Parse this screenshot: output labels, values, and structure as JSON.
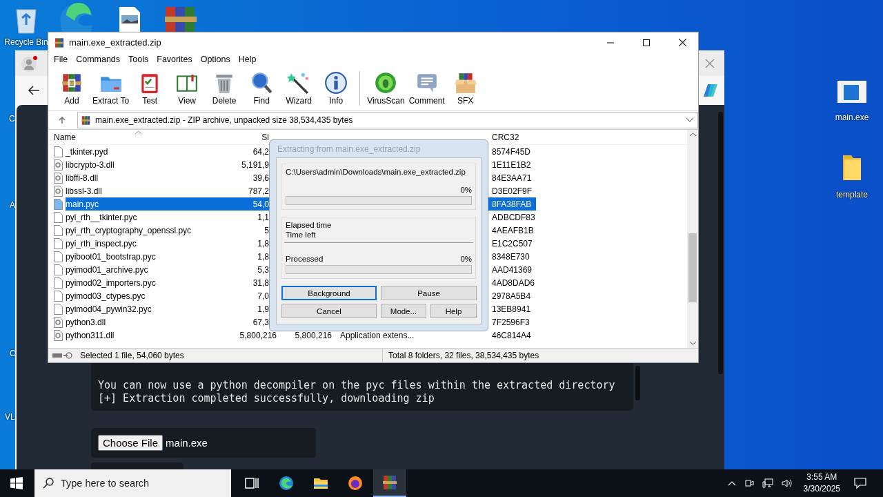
{
  "desktop": {
    "top_icons": [
      {
        "label": "Recycle Bin"
      }
    ],
    "left_edge_labels": [
      "C",
      "A",
      "C",
      "VL"
    ],
    "right_icons": [
      {
        "label": "main.exe",
        "kind": "app"
      },
      {
        "label": "template",
        "kind": "folder"
      }
    ]
  },
  "browser": {
    "terminal_lines": [
      "You can now use a python decompiler on the pyc files within the extracted directory",
      "[+] Extraction completed successfully, downloading zip"
    ],
    "file_button": "Choose File",
    "file_name": "main.exe"
  },
  "winrar": {
    "title": "main.exe_extracted.zip",
    "menu": [
      "File",
      "Commands",
      "Tools",
      "Favorites",
      "Options",
      "Help"
    ],
    "toolbar": [
      [
        "Add",
        "Extract To",
        "Test",
        "View",
        "Delete",
        "Find",
        "Wizard",
        "Info"
      ],
      [
        "VirusScan",
        "Comment",
        "SFX"
      ]
    ],
    "address": "main.exe_extracted.zip - ZIP archive, unpacked size 38,534,435 bytes",
    "columns": {
      "name": "Name",
      "size": "Si",
      "crc": "CRC32"
    },
    "rows": [
      {
        "name": "_tkinter.pyd",
        "kind": "file",
        "size": "64,2",
        "crc": "8574F45D",
        "selected": false
      },
      {
        "name": "libcrypto-3.dll",
        "kind": "dll",
        "size": "5,191,9",
        "crc": "1E11E1B2",
        "selected": false
      },
      {
        "name": "libffi-8.dll",
        "kind": "dll",
        "size": "39,6",
        "crc": "84E3AA71",
        "selected": false
      },
      {
        "name": "libssl-3.dll",
        "kind": "dll",
        "size": "787,2",
        "crc": "D3E02F9F",
        "selected": false
      },
      {
        "name": "main.pyc",
        "kind": "file",
        "size": "54,0",
        "crc": "8FA38FAB",
        "selected": true
      },
      {
        "name": "pyi_rth__tkinter.pyc",
        "kind": "file",
        "size": "1,1",
        "crc": "ADBCDF83",
        "selected": false
      },
      {
        "name": "pyi_rth_cryptography_openssl.pyc",
        "kind": "file",
        "size": "5",
        "crc": "4AEAFB1B",
        "selected": false
      },
      {
        "name": "pyi_rth_inspect.pyc",
        "kind": "file",
        "size": "1,8",
        "crc": "E1C2C507",
        "selected": false
      },
      {
        "name": "pyiboot01_bootstrap.pyc",
        "kind": "file",
        "size": "1,8",
        "crc": "8348E730",
        "selected": false
      },
      {
        "name": "pyimod01_archive.pyc",
        "kind": "file",
        "size": "5,3",
        "crc": "AAD41369",
        "selected": false
      },
      {
        "name": "pyimod02_importers.pyc",
        "kind": "file",
        "size": "31,8",
        "crc": "4AD8DAD6",
        "selected": false
      },
      {
        "name": "pyimod03_ctypes.pyc",
        "kind": "file",
        "size": "7,0",
        "crc": "2978A5B4",
        "selected": false
      },
      {
        "name": "pyimod04_pywin32.pyc",
        "kind": "file",
        "size": "1,9",
        "crc": "13EB8941",
        "selected": false
      },
      {
        "name": "python3.dll",
        "kind": "dll",
        "size": "67,3",
        "crc": "7F2596F3",
        "selected": false
      },
      {
        "name": "python311.dll",
        "kind": "dll",
        "size": "5,800,216",
        "packed": "5,800,216",
        "type": "Application extens...",
        "crc": "46C814A4",
        "selected": false
      }
    ],
    "status_left": "Selected 1 file, 54,060 bytes",
    "status_right": "Total 8 folders, 32 files, 38,534,435 bytes"
  },
  "dialog": {
    "title": "Extracting from main.exe_extracted.zip",
    "path": "C:\\Users\\admin\\Downloads\\main.exe_extracted.zip",
    "file_percent": "0%",
    "file_bar": {
      "level": 0
    },
    "elapsed_label": "Elapsed time",
    "time_left_label": "Time left",
    "processed_label": "Processed",
    "total_percent": "0%",
    "total_bar": {
      "level": 0
    },
    "buttons": [
      {
        "label": "Background",
        "focused": true
      },
      {
        "label": "Pause",
        "focused": false
      },
      {
        "label": "Cancel",
        "focused": false
      },
      {
        "label": "Mode...",
        "focused": false
      },
      {
        "label": "Help",
        "focused": false
      }
    ]
  },
  "taskbar": {
    "search_placeholder": "Type here to search",
    "apps": [
      {
        "selected": false
      },
      {
        "selected": false
      },
      {
        "selected": false
      },
      {
        "selected": false
      },
      {
        "selected": true
      }
    ],
    "time": "3:55 AM",
    "date": "3/30/2025"
  }
}
